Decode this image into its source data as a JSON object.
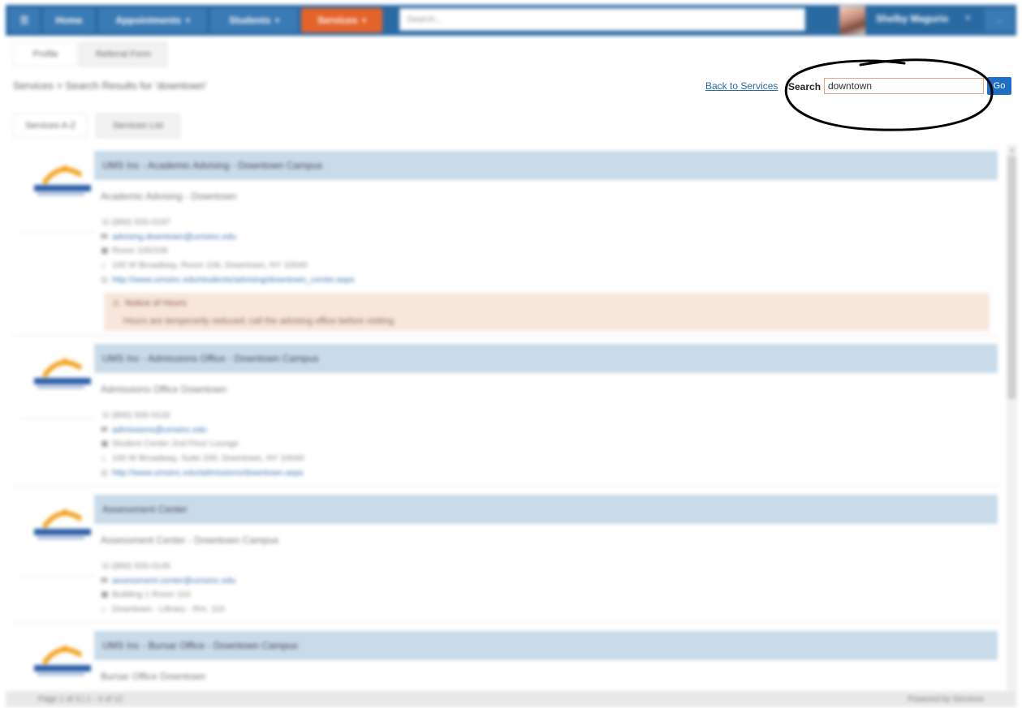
{
  "nav": {
    "items": [
      {
        "label": "Home",
        "caret": ""
      },
      {
        "label": "Appointments",
        "caret": "▾"
      },
      {
        "label": "Students",
        "caret": "▾"
      },
      {
        "label": "Services",
        "caret": "▾"
      }
    ],
    "search_placeholder": "Search...",
    "user_name": "Shelby Magurio",
    "more_label": "..."
  },
  "subtabs": [
    "Profile",
    "Referral Form"
  ],
  "breadcrumb": "Services > Search Results for 'downtown'",
  "back_link": "Back to Services",
  "search": {
    "label": "Search",
    "value": "downtown",
    "go_label": "Go"
  },
  "view_tabs": [
    "Services A-Z",
    "Services List"
  ],
  "results": [
    {
      "title": "UMS Inc - Academic Advising - Downtown Campus",
      "subtitle": "Academic Advising - Downtown",
      "phone": "(800) 555-0197",
      "email": "advising.downtown@umsinc.edu",
      "room": "Room 105/106",
      "address": "100 W Broadway, Room 106, Downtown, NY 10040",
      "website": "http://www.umsinc.edu/students/advising/downtown_center.aspx",
      "notice_title": "Notice of Hours",
      "notice_body": "Hours are temporarily reduced; call the advising office before visiting."
    },
    {
      "title": "UMS Inc - Admissions Office - Downtown Campus",
      "subtitle": "Admissions Office Downtown",
      "phone": "(800) 555-0132",
      "email": "admissions@umsinc.edu",
      "room": "Student Center 2nd Floor Lounge",
      "address": "100 W Broadway, Suite 200, Downtown, NY 10040",
      "website": "http://www.umsinc.edu/admissions/downtown.aspx"
    },
    {
      "title": "Assessment Center",
      "subtitle": "Assessment Center - Downtown Campus",
      "phone": "(800) 555-0145",
      "email": "assessment.center@umsinc.edu",
      "room": "Building 1 Room 110",
      "address": "Downtown - Library - Rm. 110"
    },
    {
      "title": "UMS Inc - Bursar Office - Downtown Campus",
      "subtitle": "Bursar Office Downtown"
    }
  ],
  "footer": {
    "left": "Page 1 of 3  |  1 - 4 of 12",
    "right": "Powered by Services"
  },
  "colors": {
    "nav_bg": "#2a6aa3",
    "active_nav": "#e4632b",
    "card_header": "#c9dbe9",
    "notice_bg": "#f7e6dc",
    "go_button": "#1f6fc7",
    "annotation": "#000000"
  }
}
